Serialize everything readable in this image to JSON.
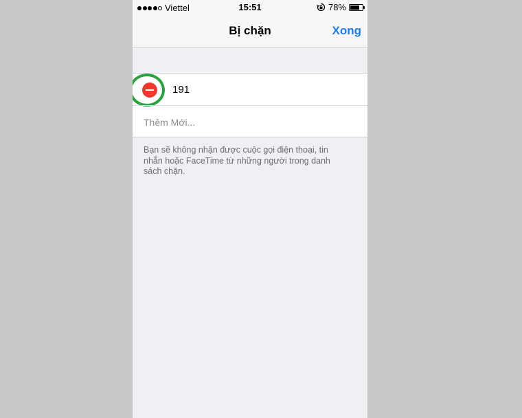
{
  "status_bar": {
    "carrier": "Viettel",
    "time": "15:51",
    "battery_percent": "78%",
    "battery_level": 0.78,
    "signal_bars_filled": 4,
    "signal_bars_total": 5
  },
  "nav": {
    "title": "Bị chặn",
    "done_label": "Xong"
  },
  "blocked_list": {
    "entries": [
      {
        "value": "191"
      }
    ],
    "add_new_label": "Thêm Mới..."
  },
  "footer": {
    "note": "Bạn sẽ không nhận được cuộc gọi điện thoại, tin nhắn hoặc FaceTime từ những người trong danh sách chặn."
  },
  "colors": {
    "accent": "#1a7cf0",
    "delete": "#f0382d",
    "highlight_ring": "#2aa33f"
  }
}
